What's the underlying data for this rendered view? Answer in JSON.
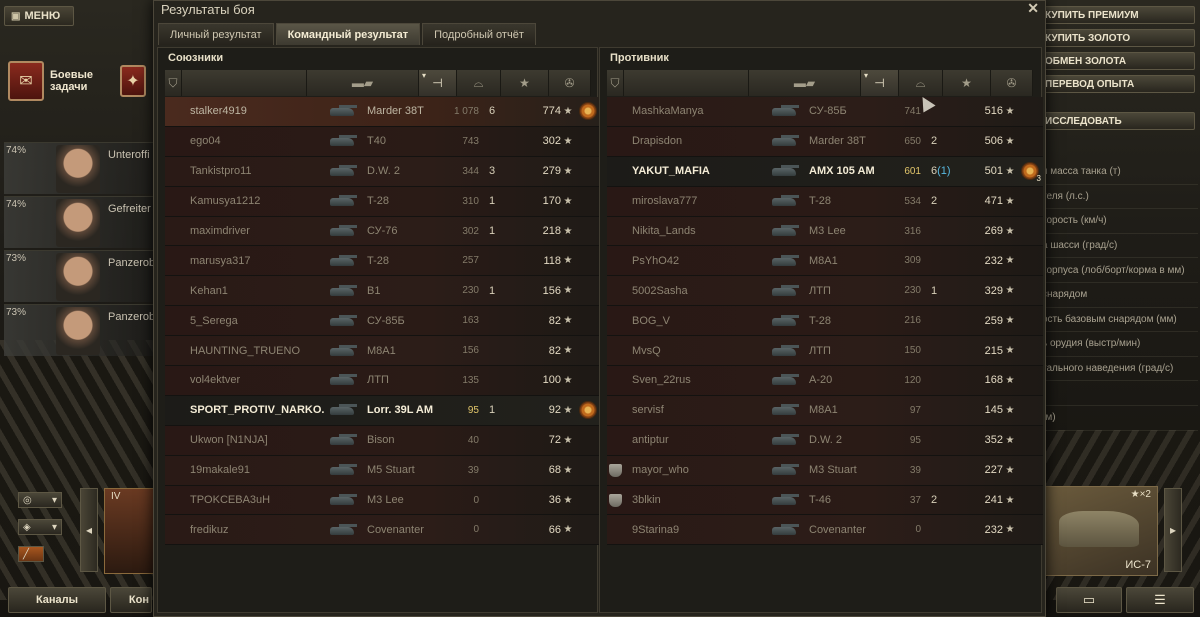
{
  "lobby": {
    "menu_label": "МЕНЮ",
    "tasks_label": "Боевые задачи",
    "crew": [
      {
        "pct": "74%",
        "role": "Unterofﬁ"
      },
      {
        "pct": "74%",
        "role": "Gefreiter"
      },
      {
        "pct": "73%",
        "role": "Panzerob"
      },
      {
        "pct": "73%",
        "role": "Panzerob"
      }
    ],
    "tank_tier": "IV",
    "channels_label": "Каналы",
    "contacts_label": "Кон",
    "right_menu": [
      "КУПИТЬ ПРЕМИУМ",
      "КУПИТЬ ЗОЛОТО",
      "ОБМЕН ЗОЛОТА",
      "ПЕРЕВОД ОПЫТА"
    ],
    "research_label": "ИССЛЕДОВАТЬ",
    "specs": [
      "я масса танка (т)",
      "теля (л.с.)",
      "корость (км/ч)",
      "а шасси (град/с)",
      "корпуса (лоб/борт/корма в мм)",
      "снарядом",
      "ость базовым снарядом (мм)",
      "ь орудия (выстр/мин)",
      "тального наведения (град/с)",
      "",
      "(м)"
    ],
    "selected_tank": "ИС-7",
    "selected_tank_badge": "★×2"
  },
  "dialog": {
    "title": "Результаты боя",
    "tabs": [
      "Личный результат",
      "Командный результат",
      "Подробный отчёт"
    ],
    "active_tab": 1,
    "allies_title": "Союзники",
    "enemies_title": "Противник"
  },
  "allies": [
    {
      "name": "stalker4919",
      "tank": "Marder 38T",
      "dmg": "1 078",
      "kills": "6",
      "xp": "774",
      "medal": true,
      "state": "me"
    },
    {
      "name": "ego04",
      "tank": "T40",
      "dmg": "743",
      "kills": "",
      "xp": "302",
      "medal": false,
      "state": "dead"
    },
    {
      "name": "Tankistpro11",
      "tank": "D.W. 2",
      "dmg": "344",
      "kills": "3",
      "xp": "279",
      "medal": false,
      "state": "dead"
    },
    {
      "name": "Kamusya1212",
      "tank": "T-28",
      "dmg": "310",
      "kills": "1",
      "xp": "170",
      "medal": false,
      "state": "dead"
    },
    {
      "name": "maximdriver",
      "tank": "СУ-76",
      "dmg": "302",
      "kills": "1",
      "xp": "218",
      "medal": false,
      "state": "dead"
    },
    {
      "name": "marusya317",
      "tank": "T-28",
      "dmg": "257",
      "kills": "",
      "xp": "118",
      "medal": false,
      "state": "dead"
    },
    {
      "name": "Kehan1",
      "tank": "B1",
      "dmg": "230",
      "kills": "1",
      "xp": "156",
      "medal": false,
      "state": "dead"
    },
    {
      "name": "5_Serega",
      "tank": "СУ-85Б",
      "dmg": "163",
      "kills": "",
      "xp": "82",
      "medal": false,
      "state": "dead"
    },
    {
      "name": "HAUNTING_TRUENO",
      "tank": "M8A1",
      "dmg": "156",
      "kills": "",
      "xp": "82",
      "medal": false,
      "state": "dead"
    },
    {
      "name": "vol4ektver",
      "tank": "ЛТП",
      "dmg": "135",
      "kills": "",
      "xp": "100",
      "medal": false,
      "state": "dead"
    },
    {
      "name": "SPORT_PROTIV_NARKO..",
      "tank": "Lorr. 39L AM",
      "dmg": "95",
      "kills": "1",
      "xp": "92",
      "medal": true,
      "state": "alive"
    },
    {
      "name": "Ukwon [N1NJA]",
      "tank": "Bison",
      "dmg": "40",
      "kills": "",
      "xp": "72",
      "medal": false,
      "state": "dead"
    },
    {
      "name": "19makale91",
      "tank": "M5 Stuart",
      "dmg": "39",
      "kills": "",
      "xp": "68",
      "medal": false,
      "state": "dead"
    },
    {
      "name": "TPOKCEBA3uH",
      "tank": "M3 Lee",
      "dmg": "0",
      "kills": "",
      "xp": "36",
      "medal": false,
      "state": "dead"
    },
    {
      "name": "fredikuz",
      "tank": "Covenanter",
      "dmg": "0",
      "kills": "",
      "xp": "66",
      "medal": false,
      "state": "dead"
    }
  ],
  "enemies": [
    {
      "name": "MashkaManya",
      "tank": "СУ-85Б",
      "dmg": "741",
      "kills": "",
      "xp": "516",
      "medal": false,
      "state": "dead",
      "platoon": false
    },
    {
      "name": "Drapisdon",
      "tank": "Marder 38T",
      "dmg": "650",
      "kills": "2",
      "xp": "506",
      "medal": false,
      "state": "dead",
      "platoon": false
    },
    {
      "name": "YAKUT_MAFIA",
      "tank": "AMX 105 AM",
      "dmg": "601",
      "kills": "6",
      "kills_extra": "(1)",
      "xp": "501",
      "medal": true,
      "medal_num": "3",
      "state": "alive",
      "platoon": false
    },
    {
      "name": "miroslava777",
      "tank": "T-28",
      "dmg": "534",
      "kills": "2",
      "xp": "471",
      "medal": false,
      "state": "dead",
      "platoon": false
    },
    {
      "name": "Nikita_Lands",
      "tank": "M3 Lee",
      "dmg": "316",
      "kills": "",
      "xp": "269",
      "medal": false,
      "state": "dead",
      "platoon": false
    },
    {
      "name": "PsYhO42",
      "tank": "M8A1",
      "dmg": "309",
      "kills": "",
      "xp": "232",
      "medal": false,
      "state": "dead",
      "platoon": false
    },
    {
      "name": "5002Sasha",
      "tank": "ЛТП",
      "dmg": "230",
      "kills": "1",
      "xp": "329",
      "medal": false,
      "state": "dead",
      "platoon": false
    },
    {
      "name": "BOG_V",
      "tank": "T-28",
      "dmg": "216",
      "kills": "",
      "xp": "259",
      "medal": false,
      "state": "dead",
      "platoon": false
    },
    {
      "name": "MvsQ",
      "tank": "ЛТП",
      "dmg": "150",
      "kills": "",
      "xp": "215",
      "medal": false,
      "state": "dead",
      "platoon": false
    },
    {
      "name": "Sven_22rus",
      "tank": "A-20",
      "dmg": "120",
      "kills": "",
      "xp": "168",
      "medal": false,
      "state": "dead",
      "platoon": false
    },
    {
      "name": "servisf",
      "tank": "M8A1",
      "dmg": "97",
      "kills": "",
      "xp": "145",
      "medal": false,
      "state": "dead",
      "platoon": false
    },
    {
      "name": "antiptur",
      "tank": "D.W. 2",
      "dmg": "95",
      "kills": "",
      "xp": "352",
      "medal": false,
      "state": "dead",
      "platoon": false
    },
    {
      "name": "mayor_who",
      "tank": "M3 Stuart",
      "dmg": "39",
      "kills": "",
      "xp": "227",
      "medal": false,
      "state": "dead",
      "platoon": true
    },
    {
      "name": "3blkin",
      "tank": "T-46",
      "dmg": "37",
      "kills": "2",
      "xp": "241",
      "medal": false,
      "state": "dead",
      "platoon": true
    },
    {
      "name": "9Starina9",
      "tank": "Covenanter",
      "dmg": "0",
      "kills": "",
      "xp": "232",
      "medal": false,
      "state": "dead",
      "platoon": false
    }
  ]
}
